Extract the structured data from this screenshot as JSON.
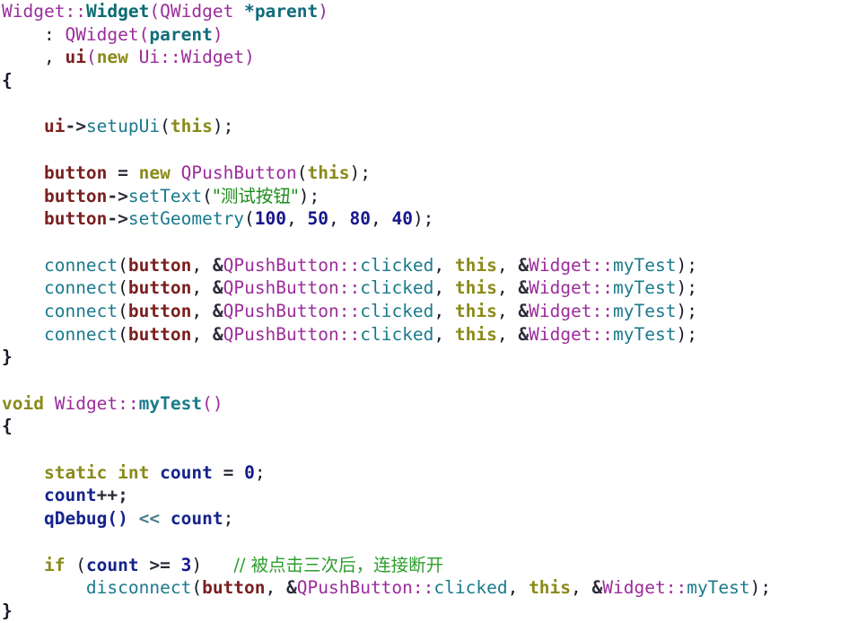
{
  "document": {
    "title": "Qt C++ source code snippet",
    "language": "C++",
    "background_color": "#ffffff",
    "font": "monospace",
    "palette": {
      "plain": "#1a1a28",
      "class": "#9b2d9b",
      "type": "#0b6b72",
      "function": "#1a7a8c",
      "member": "#7a1f1f",
      "keyword": "#8a8a1a",
      "number": "#16168c",
      "string": "#1a8c1a",
      "comment": "#2e9e2e",
      "variable": "#16238c",
      "parameter": "#116b7c"
    }
  },
  "code": {
    "lines": [
      {
        "n": 1,
        "tokens": [
          {
            "t": "Widget",
            "c": "class"
          },
          {
            "t": "::",
            "c": "punct"
          },
          {
            "t": "Widget",
            "c": "type"
          },
          {
            "t": "(",
            "c": "punct"
          },
          {
            "t": "QWidget",
            "c": "class"
          },
          {
            "t": " ",
            "c": "plain"
          },
          {
            "t": "*parent",
            "c": "param"
          },
          {
            "t": ")",
            "c": "punct"
          }
        ]
      },
      {
        "n": 2,
        "tokens": [
          {
            "t": "    : ",
            "c": "plain"
          },
          {
            "t": "QWidget",
            "c": "class"
          },
          {
            "t": "(",
            "c": "punct"
          },
          {
            "t": "parent",
            "c": "param"
          },
          {
            "t": ")",
            "c": "punct"
          }
        ]
      },
      {
        "n": 3,
        "tokens": [
          {
            "t": "    , ",
            "c": "plain"
          },
          {
            "t": "ui",
            "c": "member"
          },
          {
            "t": "(",
            "c": "punct"
          },
          {
            "t": "new",
            "c": "keyword"
          },
          {
            "t": " ",
            "c": "plain"
          },
          {
            "t": "Ui",
            "c": "class"
          },
          {
            "t": "::",
            "c": "punct"
          },
          {
            "t": "Widget",
            "c": "class"
          },
          {
            "t": ")",
            "c": "punct"
          }
        ]
      },
      {
        "n": 4,
        "tokens": [
          {
            "t": "{",
            "c": "brace"
          }
        ]
      },
      {
        "n": 5,
        "tokens": []
      },
      {
        "n": 6,
        "tokens": [
          {
            "t": "    ",
            "c": "plain"
          },
          {
            "t": "ui",
            "c": "member"
          },
          {
            "t": "->",
            "c": "op"
          },
          {
            "t": "setupUi",
            "c": "func"
          },
          {
            "t": "(",
            "c": "plain"
          },
          {
            "t": "this",
            "c": "keyword"
          },
          {
            "t": ");",
            "c": "plain"
          }
        ]
      },
      {
        "n": 7,
        "tokens": []
      },
      {
        "n": 8,
        "tokens": [
          {
            "t": "    ",
            "c": "plain"
          },
          {
            "t": "button",
            "c": "member"
          },
          {
            "t": " = ",
            "c": "op"
          },
          {
            "t": "new",
            "c": "keyword"
          },
          {
            "t": " ",
            "c": "plain"
          },
          {
            "t": "QPushButton",
            "c": "class"
          },
          {
            "t": "(",
            "c": "plain"
          },
          {
            "t": "this",
            "c": "keyword"
          },
          {
            "t": ");",
            "c": "plain"
          }
        ]
      },
      {
        "n": 9,
        "tokens": [
          {
            "t": "    ",
            "c": "plain"
          },
          {
            "t": "button",
            "c": "member"
          },
          {
            "t": "->",
            "c": "op"
          },
          {
            "t": "setText",
            "c": "func"
          },
          {
            "t": "(",
            "c": "plain"
          },
          {
            "t": "\"测试按钮\"",
            "c": "string",
            "cjk": true
          },
          {
            "t": ");",
            "c": "plain"
          }
        ]
      },
      {
        "n": 10,
        "tokens": [
          {
            "t": "    ",
            "c": "plain"
          },
          {
            "t": "button",
            "c": "member"
          },
          {
            "t": "->",
            "c": "op"
          },
          {
            "t": "setGeometry",
            "c": "func"
          },
          {
            "t": "(",
            "c": "plain"
          },
          {
            "t": "100",
            "c": "num"
          },
          {
            "t": ", ",
            "c": "plain"
          },
          {
            "t": "50",
            "c": "num"
          },
          {
            "t": ", ",
            "c": "plain"
          },
          {
            "t": "80",
            "c": "num"
          },
          {
            "t": ", ",
            "c": "plain"
          },
          {
            "t": "40",
            "c": "num"
          },
          {
            "t": ");",
            "c": "plain"
          }
        ]
      },
      {
        "n": 11,
        "tokens": []
      },
      {
        "n": 12,
        "tokens": [
          {
            "t": "    ",
            "c": "plain"
          },
          {
            "t": "connect",
            "c": "func"
          },
          {
            "t": "(",
            "c": "plain"
          },
          {
            "t": "button",
            "c": "member"
          },
          {
            "t": ", ",
            "c": "plain"
          },
          {
            "t": "&",
            "c": "op"
          },
          {
            "t": "QPushButton",
            "c": "class"
          },
          {
            "t": "::",
            "c": "punct"
          },
          {
            "t": "clicked",
            "c": "func"
          },
          {
            "t": ", ",
            "c": "plain"
          },
          {
            "t": "this",
            "c": "keyword"
          },
          {
            "t": ", ",
            "c": "plain"
          },
          {
            "t": "&",
            "c": "op"
          },
          {
            "t": "Widget",
            "c": "class"
          },
          {
            "t": "::",
            "c": "punct"
          },
          {
            "t": "myTest",
            "c": "func"
          },
          {
            "t": ");",
            "c": "plain"
          }
        ]
      },
      {
        "n": 13,
        "tokens": [
          {
            "t": "    ",
            "c": "plain"
          },
          {
            "t": "connect",
            "c": "func"
          },
          {
            "t": "(",
            "c": "plain"
          },
          {
            "t": "button",
            "c": "member"
          },
          {
            "t": ", ",
            "c": "plain"
          },
          {
            "t": "&",
            "c": "op"
          },
          {
            "t": "QPushButton",
            "c": "class"
          },
          {
            "t": "::",
            "c": "punct"
          },
          {
            "t": "clicked",
            "c": "func"
          },
          {
            "t": ", ",
            "c": "plain"
          },
          {
            "t": "this",
            "c": "keyword"
          },
          {
            "t": ", ",
            "c": "plain"
          },
          {
            "t": "&",
            "c": "op"
          },
          {
            "t": "Widget",
            "c": "class"
          },
          {
            "t": "::",
            "c": "punct"
          },
          {
            "t": "myTest",
            "c": "func"
          },
          {
            "t": ");",
            "c": "plain"
          }
        ]
      },
      {
        "n": 14,
        "tokens": [
          {
            "t": "    ",
            "c": "plain"
          },
          {
            "t": "connect",
            "c": "func"
          },
          {
            "t": "(",
            "c": "plain"
          },
          {
            "t": "button",
            "c": "member"
          },
          {
            "t": ", ",
            "c": "plain"
          },
          {
            "t": "&",
            "c": "op"
          },
          {
            "t": "QPushButton",
            "c": "class"
          },
          {
            "t": "::",
            "c": "punct"
          },
          {
            "t": "clicked",
            "c": "func"
          },
          {
            "t": ", ",
            "c": "plain"
          },
          {
            "t": "this",
            "c": "keyword"
          },
          {
            "t": ", ",
            "c": "plain"
          },
          {
            "t": "&",
            "c": "op"
          },
          {
            "t": "Widget",
            "c": "class"
          },
          {
            "t": "::",
            "c": "punct"
          },
          {
            "t": "myTest",
            "c": "func"
          },
          {
            "t": ");",
            "c": "plain"
          }
        ]
      },
      {
        "n": 15,
        "tokens": [
          {
            "t": "    ",
            "c": "plain"
          },
          {
            "t": "connect",
            "c": "func"
          },
          {
            "t": "(",
            "c": "plain"
          },
          {
            "t": "button",
            "c": "member"
          },
          {
            "t": ", ",
            "c": "plain"
          },
          {
            "t": "&",
            "c": "op"
          },
          {
            "t": "QPushButton",
            "c": "class"
          },
          {
            "t": "::",
            "c": "punct"
          },
          {
            "t": "clicked",
            "c": "func"
          },
          {
            "t": ", ",
            "c": "plain"
          },
          {
            "t": "this",
            "c": "keyword"
          },
          {
            "t": ", ",
            "c": "plain"
          },
          {
            "t": "&",
            "c": "op"
          },
          {
            "t": "Widget",
            "c": "class"
          },
          {
            "t": "::",
            "c": "punct"
          },
          {
            "t": "myTest",
            "c": "func"
          },
          {
            "t": ");",
            "c": "plain"
          }
        ]
      },
      {
        "n": 16,
        "tokens": [
          {
            "t": "}",
            "c": "brace"
          }
        ]
      },
      {
        "n": 17,
        "tokens": []
      },
      {
        "n": 18,
        "tokens": [
          {
            "t": "void",
            "c": "keyword"
          },
          {
            "t": " ",
            "c": "plain"
          },
          {
            "t": "Widget",
            "c": "class"
          },
          {
            "t": "::",
            "c": "punct"
          },
          {
            "t": "myTest",
            "c": "funcb"
          },
          {
            "t": "()",
            "c": "punct"
          }
        ]
      },
      {
        "n": 19,
        "tokens": [
          {
            "t": "{",
            "c": "brace"
          }
        ]
      },
      {
        "n": 20,
        "tokens": []
      },
      {
        "n": 21,
        "tokens": [
          {
            "t": "    ",
            "c": "plain"
          },
          {
            "t": "static",
            "c": "keyword"
          },
          {
            "t": " ",
            "c": "plain"
          },
          {
            "t": "int",
            "c": "keyword"
          },
          {
            "t": " ",
            "c": "plain"
          },
          {
            "t": "count",
            "c": "var"
          },
          {
            "t": " = ",
            "c": "op"
          },
          {
            "t": "0",
            "c": "num"
          },
          {
            "t": ";",
            "c": "plain"
          }
        ]
      },
      {
        "n": 22,
        "tokens": [
          {
            "t": "    ",
            "c": "plain"
          },
          {
            "t": "count",
            "c": "var"
          },
          {
            "t": "++;",
            "c": "op"
          }
        ]
      },
      {
        "n": 23,
        "tokens": [
          {
            "t": "    ",
            "c": "plain"
          },
          {
            "t": "qDebug",
            "c": "var"
          },
          {
            "t": "() ",
            "c": "var"
          },
          {
            "t": "<<",
            "c": "shift"
          },
          {
            "t": " ",
            "c": "plain"
          },
          {
            "t": "count",
            "c": "var"
          },
          {
            "t": ";",
            "c": "plain"
          }
        ]
      },
      {
        "n": 24,
        "tokens": []
      },
      {
        "n": 25,
        "tokens": [
          {
            "t": "    ",
            "c": "plain"
          },
          {
            "t": "if",
            "c": "keyword"
          },
          {
            "t": " (",
            "c": "plain"
          },
          {
            "t": "count",
            "c": "var"
          },
          {
            "t": " >= ",
            "c": "op"
          },
          {
            "t": "3",
            "c": "num"
          },
          {
            "t": ")   ",
            "c": "plain"
          },
          {
            "t": "// 被点击三次后，连接断开",
            "c": "comment",
            "cjk": true
          }
        ]
      },
      {
        "n": 26,
        "tokens": [
          {
            "t": "        ",
            "c": "plain"
          },
          {
            "t": "disconnect",
            "c": "func"
          },
          {
            "t": "(",
            "c": "plain"
          },
          {
            "t": "button",
            "c": "member"
          },
          {
            "t": ", ",
            "c": "plain"
          },
          {
            "t": "&",
            "c": "op"
          },
          {
            "t": "QPushButton",
            "c": "class"
          },
          {
            "t": "::",
            "c": "punct"
          },
          {
            "t": "clicked",
            "c": "func"
          },
          {
            "t": ", ",
            "c": "plain"
          },
          {
            "t": "this",
            "c": "keyword"
          },
          {
            "t": ", ",
            "c": "plain"
          },
          {
            "t": "&",
            "c": "op"
          },
          {
            "t": "Widget",
            "c": "class"
          },
          {
            "t": "::",
            "c": "punct"
          },
          {
            "t": "myTest",
            "c": "func"
          },
          {
            "t": ");",
            "c": "plain"
          }
        ]
      },
      {
        "n": 27,
        "tokens": [
          {
            "t": "}",
            "c": "brace"
          }
        ]
      }
    ]
  }
}
